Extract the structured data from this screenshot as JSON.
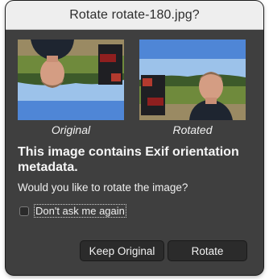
{
  "dialog": {
    "title": "Rotate rotate-180.jpg?",
    "original_caption": "Original",
    "rotated_caption": "Rotated",
    "heading": "This image contains Exif orientation metadata.",
    "question": "Would you like to rotate the image?",
    "checkbox_label": "Don't ask me again",
    "checkbox_checked": false,
    "keep_button": "Keep Original",
    "rotate_button": "Rotate"
  },
  "colors": {
    "dialog_bg": "#3f3f3f",
    "titlebar_bg": "#eeeeee",
    "button_bg": "#2b2b2b"
  }
}
